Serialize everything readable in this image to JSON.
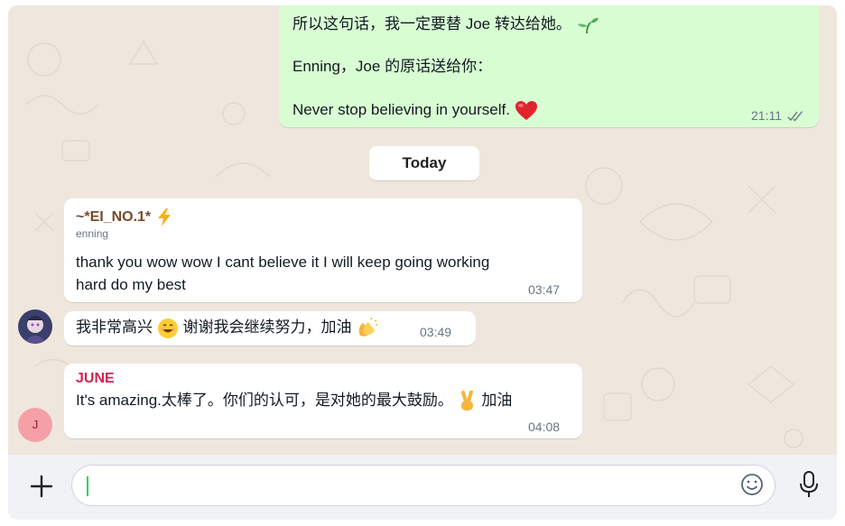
{
  "messages": {
    "m1": {
      "line1": "所以这句话，我一定要替 Joe 转达给她。",
      "line2": "Enning，Joe 的原话送给你：",
      "line3": "Never stop believing in yourself.",
      "time": "21:11"
    },
    "date_divider": "Today",
    "m2": {
      "sender": "~*EI_NO.1*",
      "sender_sub": "enning",
      "line1": "thank you wow wow I cant believe it I will keep going working",
      "line2": "hard do my best",
      "time": "03:47"
    },
    "m3": {
      "text_a": "我非常高兴",
      "text_b": "谢谢我会继续努力，加油",
      "time": "03:49"
    },
    "m4": {
      "sender": "JUNE",
      "text": "It's amazing.太棒了。你们的认可，是对她的最大鼓励。",
      "text_end": "加油",
      "time": "04:08",
      "avatar_initial": "J"
    }
  },
  "composer": {
    "placeholder": "",
    "value": ""
  },
  "icons": {
    "read_status": "double-check-icon",
    "attach": "plus-icon",
    "emoji": "smiley-icon",
    "voice": "microphone-icon"
  },
  "colors": {
    "outgoing_bubble": "#d9fdd3",
    "incoming_bubble": "#ffffff",
    "chat_background": "#efe7dd",
    "june_name": "#d32250",
    "caret": "#25d366"
  }
}
